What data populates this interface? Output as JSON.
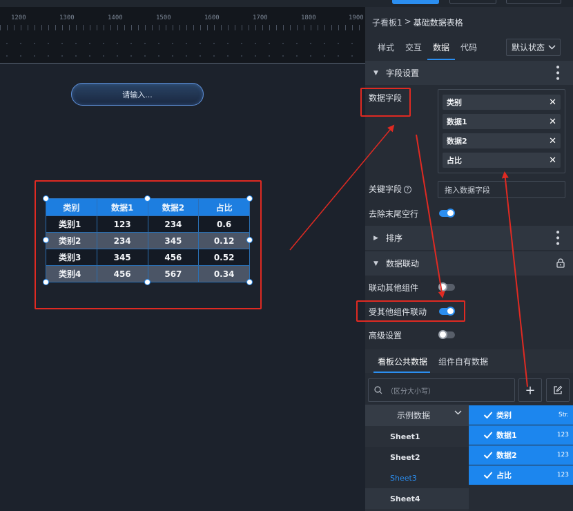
{
  "ruler": {
    "ticks": [
      "1200",
      "1300",
      "1400",
      "1500",
      "1600",
      "1700",
      "1800",
      "1900"
    ]
  },
  "canvas": {
    "search_widget_placeholder": "请输入..."
  },
  "widget_table": {
    "headers": [
      "类别",
      "数据1",
      "数据2",
      "占比"
    ],
    "rows": [
      [
        "类别1",
        "123",
        "234",
        "0.6"
      ],
      [
        "类别2",
        "234",
        "345",
        "0.12"
      ],
      [
        "类别3",
        "345",
        "456",
        "0.52"
      ],
      [
        "类别4",
        "456",
        "567",
        "0.34"
      ]
    ]
  },
  "panel": {
    "breadcrumb": {
      "parent": "子看板1",
      "separator": ">",
      "current": "基础数据表格"
    },
    "tabs": [
      "样式",
      "交互",
      "数据",
      "代码"
    ],
    "active_tab": "数据",
    "state_select": "默认状态",
    "field_settings": {
      "title": "字段设置",
      "data_fields_label": "数据字段",
      "data_fields": [
        "类别",
        "数据1",
        "数据2",
        "占比"
      ],
      "key_field_label": "关键字段",
      "key_field_placeholder": "拖入数据字段",
      "trim_empty_rows_label": "去除末尾空行",
      "trim_empty_rows": true
    },
    "sort": {
      "title": "排序"
    },
    "linkage": {
      "title": "数据联动",
      "link_others_label": "联动其他组件",
      "link_others": false,
      "linked_by_others_label": "受其他组件联动",
      "linked_by_others": true,
      "advanced_label": "高级设置",
      "advanced": false
    },
    "data_tabs": [
      "看板公共数据",
      "组件自有数据"
    ],
    "active_data_tab": "看板公共数据",
    "search_placeholder": "（区分大小写）",
    "source": {
      "name": "示例数据",
      "sheets": [
        "Sheet1",
        "Sheet2",
        "Sheet3",
        "Sheet4"
      ],
      "selected_sheet": "Sheet3"
    },
    "source_fields": [
      {
        "name": "类别",
        "type": "Str."
      },
      {
        "name": "数据1",
        "type": "123"
      },
      {
        "name": "数据2",
        "type": "123"
      },
      {
        "name": "占比",
        "type": "123"
      }
    ]
  },
  "colors": {
    "accent": "#2b8ef0",
    "annotation": "#e02a22",
    "panel_bg": "#262c35",
    "canvas_bg": "#1c222c"
  }
}
